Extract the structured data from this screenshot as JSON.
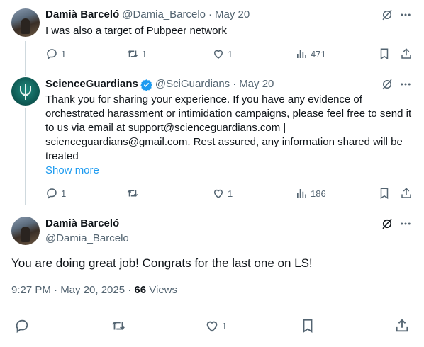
{
  "reply1": {
    "name": "Damià Barceló",
    "handle": "@Damia_Barcelo",
    "dot": "·",
    "date": "May 20",
    "text": "I was also a target of Pubpeer network",
    "replies": "1",
    "reposts": "1",
    "likes": "1",
    "views": "471"
  },
  "reply2": {
    "name": "ScienceGuardians",
    "handle": "@SciGuardians",
    "dot": "·",
    "date": "May 20",
    "text": "Thank you for sharing your experience. If you have any evidence of orchestrated harassment or intimidation campaigns, please feel free to send it to us via email at support@scienceguardians.com | scienceguardians@gmail.com. Rest assured, any information shared will be treated",
    "show_more": "Show more",
    "replies": "1",
    "reposts": "",
    "likes": "1",
    "views": "186"
  },
  "main": {
    "name": "Damià Barceló",
    "handle": "@Damia_Barcelo",
    "text": "You are doing great job! Congrats for the last one on LS!",
    "time": "9:27 PM · May 20, 2025 · ",
    "views_count": "66",
    "views_label": " Views",
    "likes": "1"
  },
  "colors": {
    "accent": "#1d9bf0",
    "muted": "#536471",
    "text": "#0f1419",
    "line": "#cfd9de"
  }
}
